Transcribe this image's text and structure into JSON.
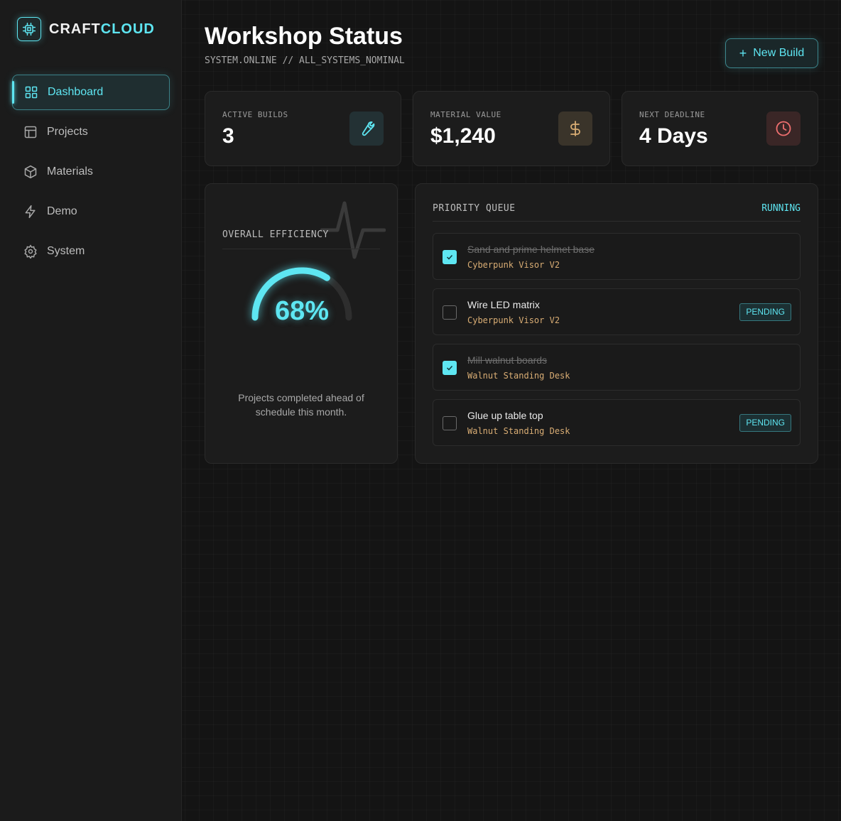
{
  "brand": {
    "part1": "CRAFT",
    "part2": "CLOUD",
    "icon": "chip-icon"
  },
  "sidebar": {
    "items": [
      {
        "label": "Dashboard",
        "icon": "grid-icon",
        "active": true
      },
      {
        "label": "Projects",
        "icon": "layout-icon",
        "active": false
      },
      {
        "label": "Materials",
        "icon": "box-icon",
        "active": false
      },
      {
        "label": "Demo",
        "icon": "bolt-icon",
        "active": false
      },
      {
        "label": "System",
        "icon": "gear-icon",
        "active": false
      }
    ]
  },
  "header": {
    "title": "Workshop Status",
    "subtitle": "SYSTEM.ONLINE // ALL_SYSTEMS_NOMINAL",
    "new_build_label": "New Build"
  },
  "stats": [
    {
      "label": "ACTIVE BUILDS",
      "value": "3",
      "icon": "wrench-icon",
      "accent": "#5ee6f2"
    },
    {
      "label": "MATERIAL VALUE",
      "value": "$1,240",
      "icon": "dollar-icon",
      "accent": "#d9ad74"
    },
    {
      "label": "NEXT DEADLINE",
      "value": "4 Days",
      "icon": "clock-icon",
      "accent": "#f07070"
    }
  ],
  "efficiency": {
    "title": "OVERALL EFFICIENCY",
    "percent": 68,
    "percent_label": "68%",
    "description": "Projects completed ahead of schedule this month."
  },
  "queue": {
    "title": "PRIORITY QUEUE",
    "status": "RUNNING",
    "items": [
      {
        "task": "Sand and prime helmet base",
        "project": "Cyberpunk Visor V2",
        "done": true,
        "badge": ""
      },
      {
        "task": "Wire LED matrix",
        "project": "Cyberpunk Visor V2",
        "done": false,
        "badge": "PENDING"
      },
      {
        "task": "Mill walnut boards",
        "project": "Walnut Standing Desk",
        "done": true,
        "badge": ""
      },
      {
        "task": "Glue up table top",
        "project": "Walnut Standing Desk",
        "done": false,
        "badge": "PENDING"
      }
    ]
  },
  "colors": {
    "accent": "#5ee6f2",
    "amber": "#d9ad74",
    "danger": "#f07070",
    "background": "#141414"
  }
}
